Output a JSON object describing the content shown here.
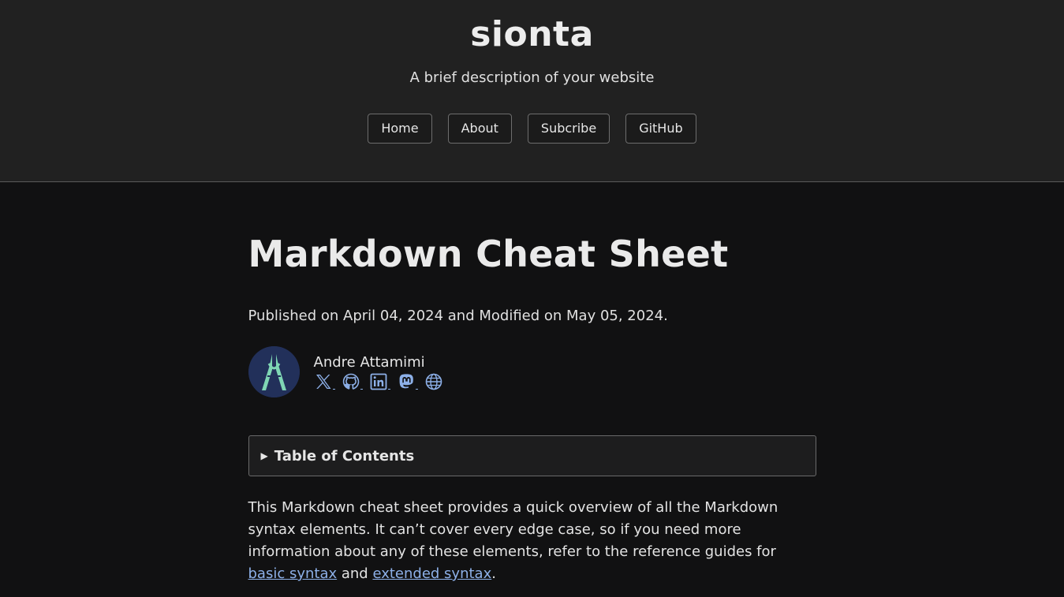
{
  "site": {
    "title": "sionta",
    "description": "A brief description of your website",
    "nav": [
      "Home",
      "About",
      "Subcribe",
      "GitHub"
    ]
  },
  "post": {
    "title": "Markdown Cheat Sheet",
    "meta": "Published on April 04, 2024 and Modified on May 05, 2024.",
    "author": {
      "name": "Andre Attamimi",
      "socials": [
        "x-icon",
        "github-icon",
        "linkedin-icon",
        "mastodon-icon",
        "globe-icon"
      ]
    },
    "toc_label": "Table of Contents",
    "toc_arrow": "▶",
    "intro": {
      "text_before": "This Markdown cheat sheet provides a quick overview of all the Markdown syntax elements. It can’t cover every edge case, so if you need more information about any of these elements, refer to the reference guides for ",
      "link1": "basic syntax",
      "between": " and ",
      "link2": "extended syntax",
      "after": "."
    }
  },
  "colors": {
    "page_bg": "#111112",
    "header_bg": "#212121",
    "link": "#8db0e8",
    "avatar_bg": "#22305a",
    "avatar_fg": "#7fd6b4"
  }
}
